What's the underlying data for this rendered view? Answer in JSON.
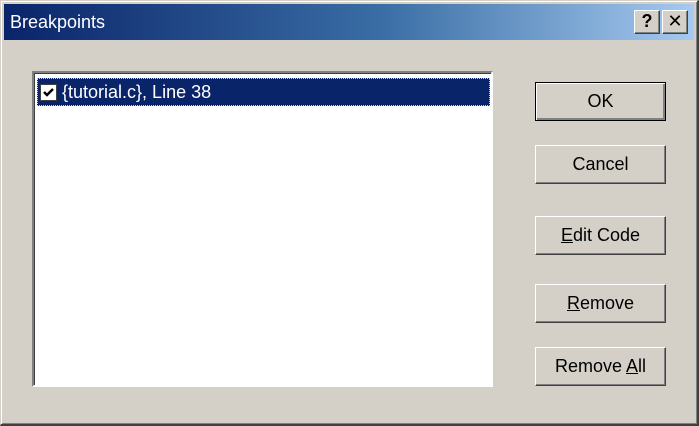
{
  "window": {
    "title": "Breakpoints",
    "help_button": "?",
    "close_button": "✕"
  },
  "breakpoints": {
    "items": [
      {
        "checked": true,
        "label": "{tutorial.c}, Line 38"
      }
    ]
  },
  "buttons": {
    "ok": "OK",
    "cancel": "Cancel",
    "edit_code": {
      "mnemonic": "E",
      "rest": "dit Code"
    },
    "remove": {
      "mnemonic": "R",
      "rest": "emove"
    },
    "remove_all": {
      "before": "Remove ",
      "mnemonic": "A",
      "rest": "ll"
    }
  },
  "colors": {
    "dialog_face": "#d4d0c8",
    "title_gradient_start": "#0a246a",
    "title_gradient_end": "#a6caf0",
    "selection": "#0a246a"
  },
  "icons": {
    "checkbox": "check-icon"
  }
}
